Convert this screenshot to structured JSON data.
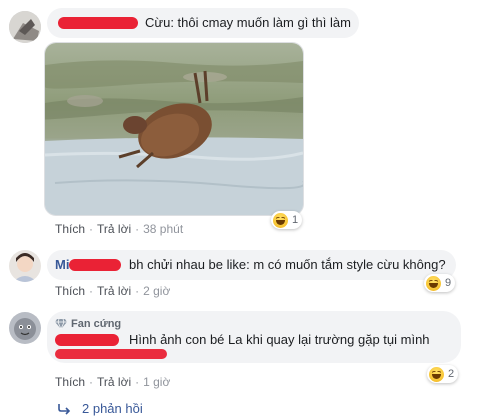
{
  "comments": [
    {
      "text": "Cừu: thôi cmay muốn làm gì thì làm",
      "actions": {
        "like": "Thích",
        "reply": "Trả lời",
        "time": "38 phút"
      },
      "reaction": {
        "icon": "haha-emoji-icon",
        "count": "1"
      }
    },
    {
      "text": "bh chửi nhau be like: m có muốn tắm style cừu không?",
      "actions": {
        "like": "Thích",
        "reply": "Trả lời",
        "time": "2 giờ"
      },
      "reaction": {
        "icon": "haha-emoji-icon",
        "count": "9"
      }
    },
    {
      "badge": "Fan cứng",
      "text_line1": "Hình ảnh con bé La khi quay lại trường gặp tụi mình",
      "actions": {
        "like": "Thích",
        "reply": "Trả lời",
        "time": "1 giờ"
      },
      "reaction": {
        "icon": "haha-emoji-icon",
        "count": "2"
      }
    }
  ],
  "view_replies": "2 phản hồi",
  "colors": {
    "link": "#385898",
    "bubble": "#f2f3f5",
    "redaction": "#e9162a"
  }
}
